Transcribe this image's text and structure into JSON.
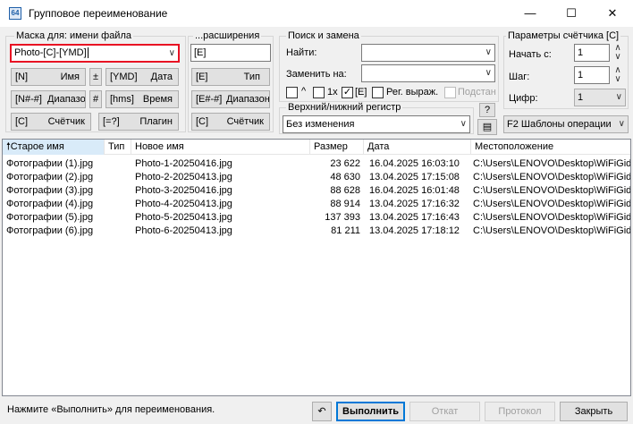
{
  "window": {
    "title": "Групповое переименование",
    "minimize_glyph": "—",
    "maximize_glyph": "☐",
    "close_glyph": "✕"
  },
  "mask": {
    "legend": "Маска для: имени файла",
    "value": "Photo-[C]-[YMD]",
    "buttons": [
      {
        "key": "[N]",
        "label": "Имя"
      },
      {
        "key": "±",
        "label": ""
      },
      {
        "key": "[YMD]",
        "label": "Дата"
      },
      {
        "key": "[N#-#]",
        "label": "Диапазон"
      },
      {
        "key": "#",
        "label": ""
      },
      {
        "key": "[hms]",
        "label": "Время"
      },
      {
        "key": "[C]",
        "label": "Счётчик"
      },
      {
        "key": "[=?]",
        "label": "Плагин"
      }
    ]
  },
  "extension": {
    "legend": "...расширения",
    "value": "[E]",
    "buttons": [
      {
        "key": "[E]",
        "label": "Тип"
      },
      {
        "key": "[E#-#]",
        "label": "Диапазон"
      },
      {
        "key": "[C]",
        "label": "Счётчик"
      }
    ]
  },
  "search": {
    "legend": "Поиск и замена",
    "find_label": "Найти:",
    "find_value": "",
    "replace_label": "Заменить на:",
    "replace_value": "",
    "opt_caret": "^",
    "opt_once": "1x",
    "opt_ext": "[E]",
    "opt_regex": "Рег. выраж.",
    "opt_subst": "Подстан",
    "case_legend": "Верхний/нижний регистр",
    "case_value": "Без изменения",
    "help_glyph": "?"
  },
  "counter": {
    "legend": "Параметры счётчика [C]",
    "start_label": "Начать с:",
    "start_value": "1",
    "step_label": "Шаг:",
    "step_value": "1",
    "digits_label": "Цифр:",
    "digits_value": "1",
    "templates_label": "F2 Шаблоны операции"
  },
  "table": {
    "columns": [
      "Старое имя",
      "Тип",
      "Новое имя",
      "Размер",
      "Дата",
      "Местоположение"
    ],
    "rows": [
      {
        "old": "Фотографии (1).jpg",
        "type": "",
        "new": "Photo-1-20250416.jpg",
        "size": "23 622",
        "date": "16.04.2025 16:03:10",
        "path": "C:\\Users\\LENOVO\\Desktop\\WiFiGid"
      },
      {
        "old": "Фотографии (2).jpg",
        "type": "",
        "new": "Photo-2-20250413.jpg",
        "size": "48 630",
        "date": "13.04.2025 17:15:08",
        "path": "C:\\Users\\LENOVO\\Desktop\\WiFiGid"
      },
      {
        "old": "Фотографии (3).jpg",
        "type": "",
        "new": "Photo-3-20250416.jpg",
        "size": "88 628",
        "date": "16.04.2025 16:01:48",
        "path": "C:\\Users\\LENOVO\\Desktop\\WiFiGid"
      },
      {
        "old": "Фотографии (4).jpg",
        "type": "",
        "new": "Photo-4-20250413.jpg",
        "size": "88 914",
        "date": "13.04.2025 17:16:32",
        "path": "C:\\Users\\LENOVO\\Desktop\\WiFiGid"
      },
      {
        "old": "Фотографии (5).jpg",
        "type": "",
        "new": "Photo-5-20250413.jpg",
        "size": "137 393",
        "date": "13.04.2025 17:16:43",
        "path": "C:\\Users\\LENOVO\\Desktop\\WiFiGid"
      },
      {
        "old": "Фотографии (6).jpg",
        "type": "",
        "new": "Photo-6-20250413.jpg",
        "size": "81 211",
        "date": "13.04.2025 17:18:12",
        "path": "C:\\Users\\LENOVO\\Desktop\\WiFiGid"
      }
    ]
  },
  "footer": {
    "status": "Нажмите «Выполнить» для переименования.",
    "undo_glyph": "↶",
    "run": "Выполнить",
    "rollback": "Откат",
    "log": "Протокол",
    "close": "Закрыть"
  },
  "colors": {
    "highlight_border": "#e81123",
    "sorted_header": "#d9ebf9",
    "default_button_border": "#0078d7"
  }
}
